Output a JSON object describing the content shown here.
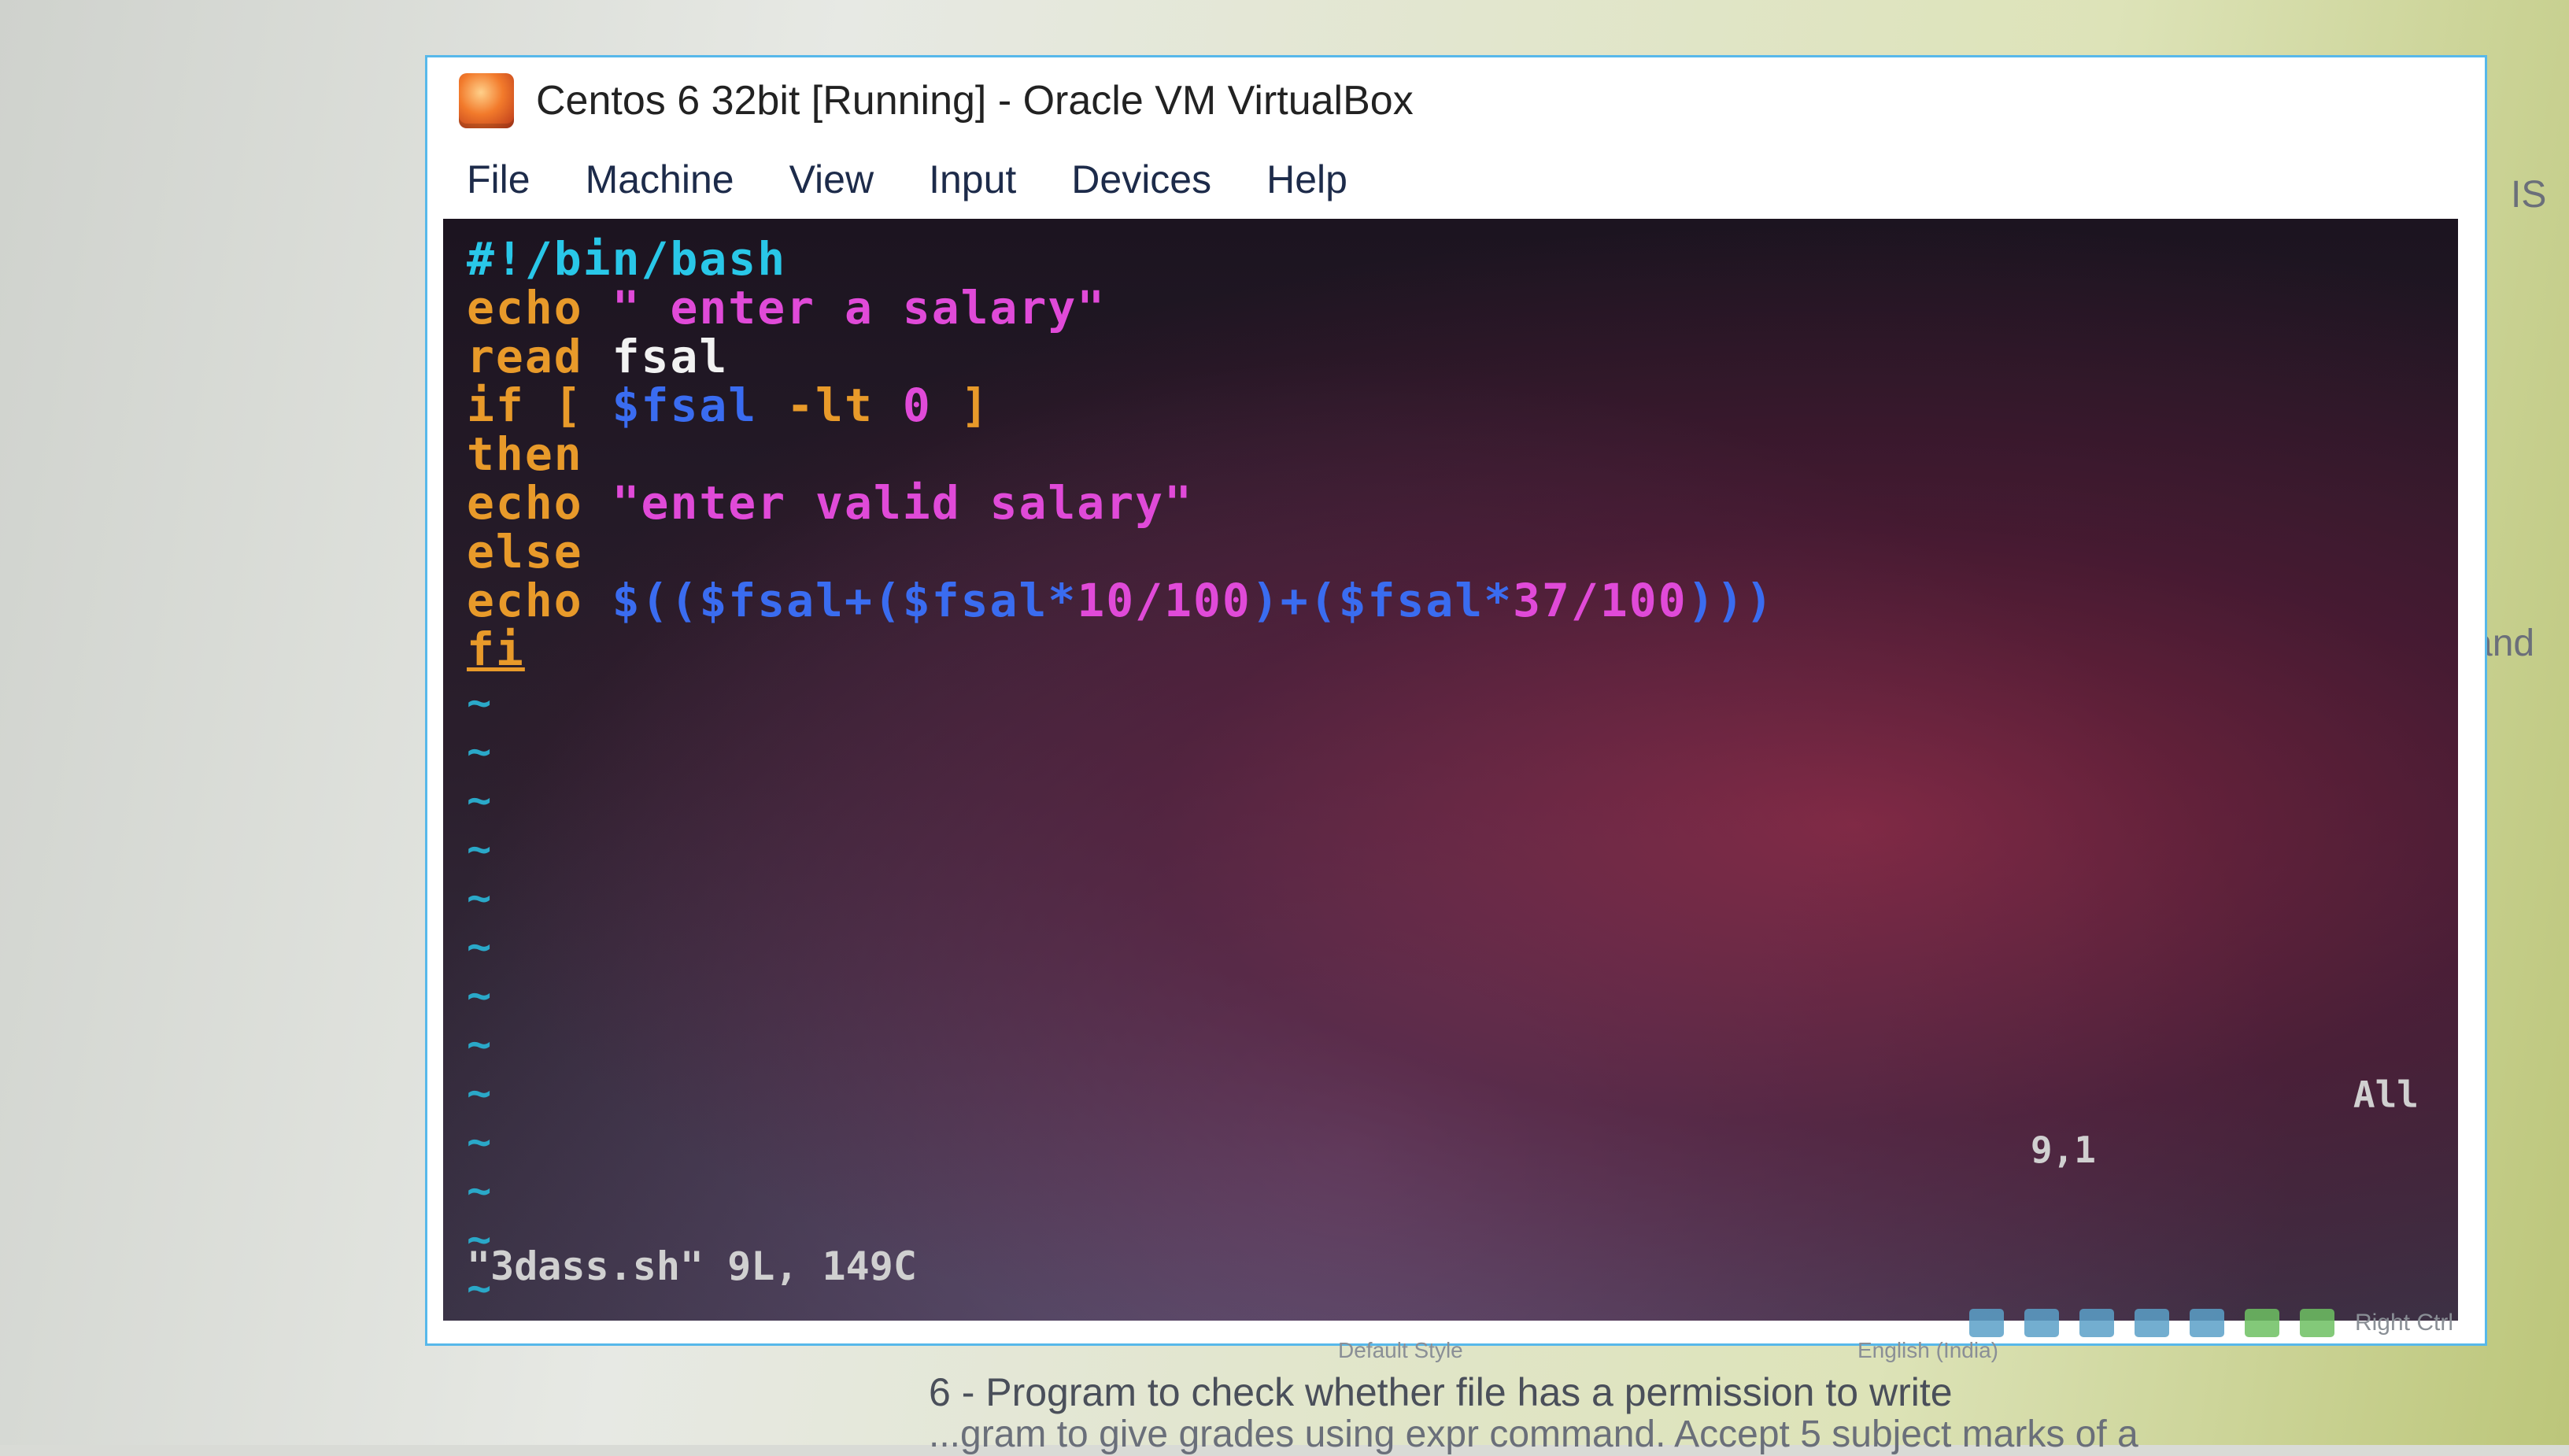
{
  "window": {
    "title": "Centos 6 32bit [Running] - Oracle VM VirtualBox"
  },
  "menu": {
    "items": [
      "File",
      "Machine",
      "View",
      "Input",
      "Devices",
      "Help"
    ]
  },
  "editor": {
    "lines": [
      [
        {
          "t": "#!/bin/bash",
          "c": "shebang"
        }
      ],
      [
        {
          "t": "echo",
          "c": "keyword"
        },
        {
          "t": " \" enter a salary\"",
          "c": "string"
        }
      ],
      [
        {
          "t": "read",
          "c": "keyword"
        },
        {
          "t": " fsal",
          "c": "plain"
        }
      ],
      [
        {
          "t": "if",
          "c": "keyword"
        },
        {
          "t": " [ ",
          "c": "keyword"
        },
        {
          "t": "$fsal",
          "c": "var"
        },
        {
          "t": " -lt ",
          "c": "keyword"
        },
        {
          "t": "0",
          "c": "number"
        },
        {
          "t": " ]",
          "c": "keyword"
        }
      ],
      [
        {
          "t": "then",
          "c": "keyword"
        }
      ],
      [
        {
          "t": "echo",
          "c": "keyword"
        },
        {
          "t": " \"enter valid salary\"",
          "c": "string"
        }
      ],
      [
        {
          "t": "else",
          "c": "keyword"
        }
      ],
      [
        {
          "t": "echo",
          "c": "keyword"
        },
        {
          "t": " $(($fsal+($fsal*",
          "c": "var"
        },
        {
          "t": "10/100",
          "c": "number"
        },
        {
          "t": ")+($fsal*",
          "c": "var"
        },
        {
          "t": "37/100",
          "c": "number"
        },
        {
          "t": ")))",
          "c": "var"
        }
      ],
      [
        {
          "t": "fi",
          "c": "keyword"
        }
      ]
    ],
    "tilde_count": 14,
    "tilde_char": "~",
    "status_file": "\"3dass.sh\" 9L, 149C",
    "status_position": "9,1",
    "status_scroll": "All"
  },
  "vbox_status": {
    "host_key": "Right Ctrl"
  },
  "document": {
    "line_6": "6 - Program to check whether file has a permission to write",
    "line_7": "...gram to give grades using expr command. Accept 5 subject marks of a",
    "language": "English (India)",
    "style": "Default Style",
    "edge_right_1": "IS",
    "edge_right_2": "and"
  },
  "colors": {
    "shebang": "#29c7e8",
    "keyword": "#e89a2a",
    "string": "#e04ad8",
    "var": "#3a6cf0",
    "plain": "#f2f2f2",
    "number": "#e04ad8",
    "window_border": "#57b8ea"
  }
}
